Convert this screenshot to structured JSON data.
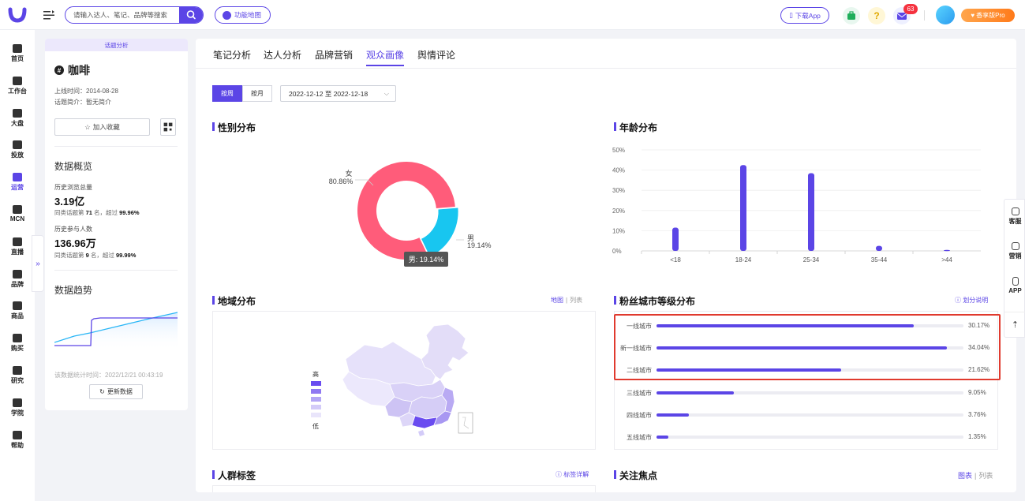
{
  "topbar": {
    "search_placeholder": "请输入达人、笔记、品牌等搜索",
    "map_label": "功能地图",
    "download_label": "下载App",
    "mail_badge": "63",
    "pro_label": "香享版Pro"
  },
  "nav": {
    "items": [
      {
        "label": "首页",
        "icon": "home-icon"
      },
      {
        "label": "工作台",
        "icon": "workbench-icon"
      },
      {
        "label": "大盘",
        "icon": "dashboard-icon"
      },
      {
        "label": "投放",
        "icon": "ads-icon"
      },
      {
        "label": "运营",
        "icon": "operation-icon",
        "active": true
      },
      {
        "label": "MCN",
        "icon": "mcn-icon"
      },
      {
        "label": "直播",
        "icon": "live-icon"
      },
      {
        "label": "品牌",
        "icon": "brand-icon"
      },
      {
        "label": "商品",
        "icon": "goods-icon"
      },
      {
        "label": "购买",
        "icon": "cart-icon"
      },
      {
        "label": "研究",
        "icon": "research-icon"
      },
      {
        "label": "学院",
        "icon": "academy-icon"
      },
      {
        "label": "帮助",
        "icon": "help-icon"
      }
    ],
    "collapse_glyph": "»"
  },
  "topic": {
    "tag": "话题分析",
    "title": "咖啡",
    "online_time": "上线时间：2014-08-28",
    "intro": "话题简介：暂无简介",
    "fav_label": "加入收藏",
    "overview_title": "数据概览",
    "views_label": "历史浏览总量",
    "views_value": "3.19亿",
    "views_rank_prefix": "同类话题第",
    "views_rank": "71",
    "views_rank_mid": "名，超过",
    "views_pct": "99.96%",
    "people_label": "历史参与人数",
    "people_value": "136.96万",
    "people_rank_prefix": "同类话题第",
    "people_rank": "9",
    "people_rank_mid": "名，超过",
    "people_pct": "99.99%",
    "trend_title": "数据趋势",
    "update_time": "该数据统计时间：2022/12/21 00:43:19",
    "update_label": "更新数据"
  },
  "main": {
    "tabs": [
      "笔记分析",
      "达人分析",
      "品牌营销",
      "观众画像",
      "舆情评论"
    ],
    "active_tab": 3,
    "period_week": "按周",
    "period_month": "按月",
    "date_range": "2022-12-12 至 2022-12-18",
    "gender_title": "性别分布",
    "age_title": "年龄分布",
    "region_title": "地域分布",
    "region_view_map": "地图",
    "region_view_list": "列表",
    "city_title": "粉丝城市等级分布",
    "city_help": "划分说明",
    "crowd_title": "人群标签",
    "crowd_help": "标签详解",
    "focus_title": "关注焦点",
    "focus_view_chart": "图表",
    "focus_view_list": "列表",
    "map_legend_high": "高",
    "map_legend_low": "低"
  },
  "colors": {
    "accent": "#5b45e6",
    "female": "#ff5c7a",
    "male": "#18c6f0",
    "highlight": "#e03a2e"
  },
  "chart_data": [
    {
      "type": "pie",
      "title": "性别分布",
      "categories": [
        "女",
        "男"
      ],
      "values": [
        80.86,
        19.14
      ],
      "labels": [
        "80.86%",
        "19.14%"
      ],
      "tooltip": "男: 19.14%"
    },
    {
      "type": "bar",
      "title": "年龄分布",
      "categories": [
        "<18",
        "18-24",
        "25-34",
        "35-44",
        ">44"
      ],
      "values": [
        11.5,
        42.5,
        38.5,
        2.5,
        0.5
      ],
      "ylim": [
        0,
        50
      ],
      "yticks": [
        "0%",
        "10%",
        "20%",
        "30%",
        "40%",
        "50%"
      ]
    },
    {
      "type": "bar",
      "title": "粉丝城市等级分布",
      "categories": [
        "一线城市",
        "新一线城市",
        "二线城市",
        "三线城市",
        "四线城市",
        "五线城市"
      ],
      "values": [
        30.17,
        34.04,
        21.62,
        9.05,
        3.76,
        1.35
      ],
      "labels": [
        "30.17%",
        "34.04%",
        "21.62%",
        "9.05%",
        "3.76%",
        "1.35%"
      ]
    }
  ],
  "right_tools": [
    {
      "label": "客服",
      "icon": "headset-icon"
    },
    {
      "label": "营销",
      "icon": "marketing-icon"
    },
    {
      "label": "APP",
      "icon": "phone-icon"
    }
  ]
}
